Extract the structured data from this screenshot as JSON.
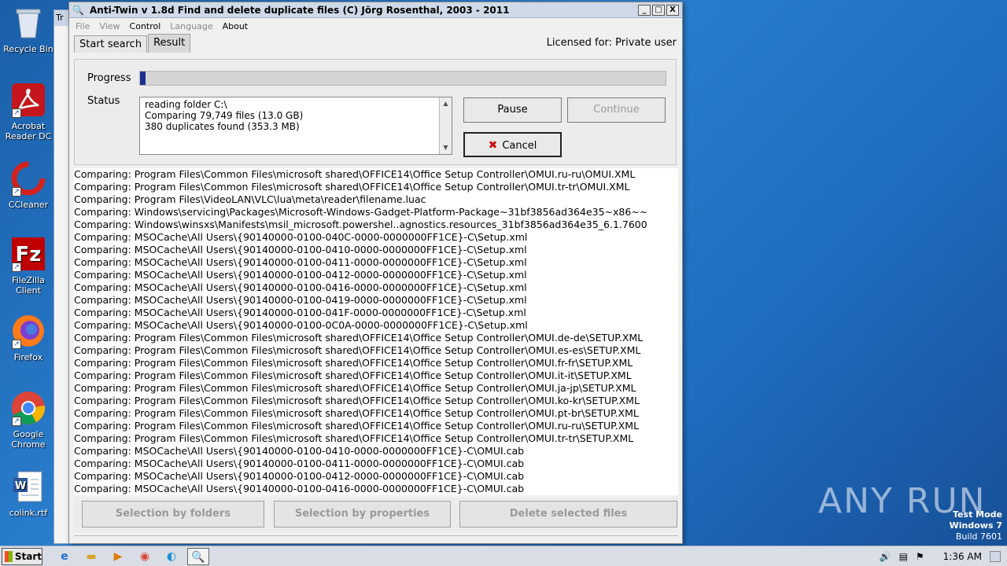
{
  "desktop": {
    "icons": [
      {
        "label": "Recycle Bin",
        "icon": "recycle-bin-icon"
      },
      {
        "label": "Acrobat Reader DC",
        "icon": "acrobat-icon"
      },
      {
        "label": "CCleaner",
        "icon": "ccleaner-icon"
      },
      {
        "label": "FileZilla Client",
        "icon": "filezilla-icon"
      },
      {
        "label": "Firefox",
        "icon": "firefox-icon"
      },
      {
        "label": "Google Chrome",
        "icon": "chrome-icon"
      },
      {
        "label": "colink.rtf",
        "icon": "word-document-icon"
      }
    ],
    "bg_window_tab": "Tr"
  },
  "window": {
    "title": "Anti-Twin    v 1.8d    Find and delete duplicate files    (C) Jörg Rosenthal, 2003 - 2011",
    "controls": {
      "minimize": "_",
      "maximize": "□",
      "close": "X"
    },
    "menu": [
      {
        "label": "File",
        "enabled": false
      },
      {
        "label": "View",
        "enabled": false
      },
      {
        "label": "Control",
        "enabled": true
      },
      {
        "label": "Language",
        "enabled": false
      },
      {
        "label": "About",
        "enabled": true
      }
    ],
    "tabs": [
      {
        "label": "Start search",
        "active": false
      },
      {
        "label": "Result",
        "active": true
      }
    ],
    "licensed": "Licensed for: Private user",
    "progress_label": "Progress",
    "progress_fraction": 0.01,
    "status_label": "Status",
    "status_lines": [
      "reading folder C:\\",
      "Comparing 79,749 files (13.0 GB)",
      "380 duplicates found (353.3 MB)"
    ],
    "buttons": {
      "pause": "Pause",
      "continue": "Continue",
      "cancel": "Cancel"
    },
    "log": [
      "Comparing:  Program Files\\Common Files\\microsoft shared\\OFFICE14\\Office Setup Controller\\OMUI.ru-ru\\OMUI.XML",
      "Comparing:  Program Files\\Common Files\\microsoft shared\\OFFICE14\\Office Setup Controller\\OMUI.tr-tr\\OMUI.XML",
      "Comparing:  Program Files\\VideoLAN\\VLC\\lua\\meta\\reader\\filename.luac",
      "Comparing:  Windows\\servicing\\Packages\\Microsoft-Windows-Gadget-Platform-Package~31bf3856ad364e35~x86~~",
      "Comparing:  Windows\\winsxs\\Manifests\\msil_microsoft.powershel..agnostics.resources_31bf3856ad364e35_6.1.7600",
      "Comparing:  MSOCache\\All Users\\{90140000-0100-040C-0000-0000000FF1CE}-C\\Setup.xml",
      "Comparing:  MSOCache\\All Users\\{90140000-0100-0410-0000-0000000FF1CE}-C\\Setup.xml",
      "Comparing:  MSOCache\\All Users\\{90140000-0100-0411-0000-0000000FF1CE}-C\\Setup.xml",
      "Comparing:  MSOCache\\All Users\\{90140000-0100-0412-0000-0000000FF1CE}-C\\Setup.xml",
      "Comparing:  MSOCache\\All Users\\{90140000-0100-0416-0000-0000000FF1CE}-C\\Setup.xml",
      "Comparing:  MSOCache\\All Users\\{90140000-0100-0419-0000-0000000FF1CE}-C\\Setup.xml",
      "Comparing:  MSOCache\\All Users\\{90140000-0100-041F-0000-0000000FF1CE}-C\\Setup.xml",
      "Comparing:  MSOCache\\All Users\\{90140000-0100-0C0A-0000-0000000FF1CE}-C\\Setup.xml",
      "Comparing:  Program Files\\Common Files\\microsoft shared\\OFFICE14\\Office Setup Controller\\OMUI.de-de\\SETUP.XML",
      "Comparing:  Program Files\\Common Files\\microsoft shared\\OFFICE14\\Office Setup Controller\\OMUI.es-es\\SETUP.XML",
      "Comparing:  Program Files\\Common Files\\microsoft shared\\OFFICE14\\Office Setup Controller\\OMUI.fr-fr\\SETUP.XML",
      "Comparing:  Program Files\\Common Files\\microsoft shared\\OFFICE14\\Office Setup Controller\\OMUI.it-it\\SETUP.XML",
      "Comparing:  Program Files\\Common Files\\microsoft shared\\OFFICE14\\Office Setup Controller\\OMUI.ja-jp\\SETUP.XML",
      "Comparing:  Program Files\\Common Files\\microsoft shared\\OFFICE14\\Office Setup Controller\\OMUI.ko-kr\\SETUP.XML",
      "Comparing:  Program Files\\Common Files\\microsoft shared\\OFFICE14\\Office Setup Controller\\OMUI.pt-br\\SETUP.XML",
      "Comparing:  Program Files\\Common Files\\microsoft shared\\OFFICE14\\Office Setup Controller\\OMUI.ru-ru\\SETUP.XML",
      "Comparing:  Program Files\\Common Files\\microsoft shared\\OFFICE14\\Office Setup Controller\\OMUI.tr-tr\\SETUP.XML",
      "Comparing:  MSOCache\\All Users\\{90140000-0100-0410-0000-0000000FF1CE}-C\\OMUI.cab",
      "Comparing:  MSOCache\\All Users\\{90140000-0100-0411-0000-0000000FF1CE}-C\\OMUI.cab",
      "Comparing:  MSOCache\\All Users\\{90140000-0100-0412-0000-0000000FF1CE}-C\\OMUI.cab",
      "Comparing:  MSOCache\\All Users\\{90140000-0100-0416-0000-0000000FF1CE}-C\\OMUI.cab"
    ],
    "bottom_buttons": {
      "by_folders": "Selection by folders",
      "by_properties": "Selection by properties",
      "delete": "Delete selected files"
    }
  },
  "watermark": {
    "brand": "ANY RUN",
    "test_mode": "Test Mode",
    "os": "Windows 7",
    "build": "Build 7601"
  },
  "taskbar": {
    "start_label": "Start",
    "pinned": [
      "ie-icon",
      "explorer-icon",
      "media-player-icon",
      "chrome-icon",
      "edge-icon",
      "anti-twin-icon"
    ],
    "time": "1:36 AM"
  },
  "colors": {
    "progress_fill": "#1b2f8c",
    "cancel_x": "#cc1010"
  }
}
